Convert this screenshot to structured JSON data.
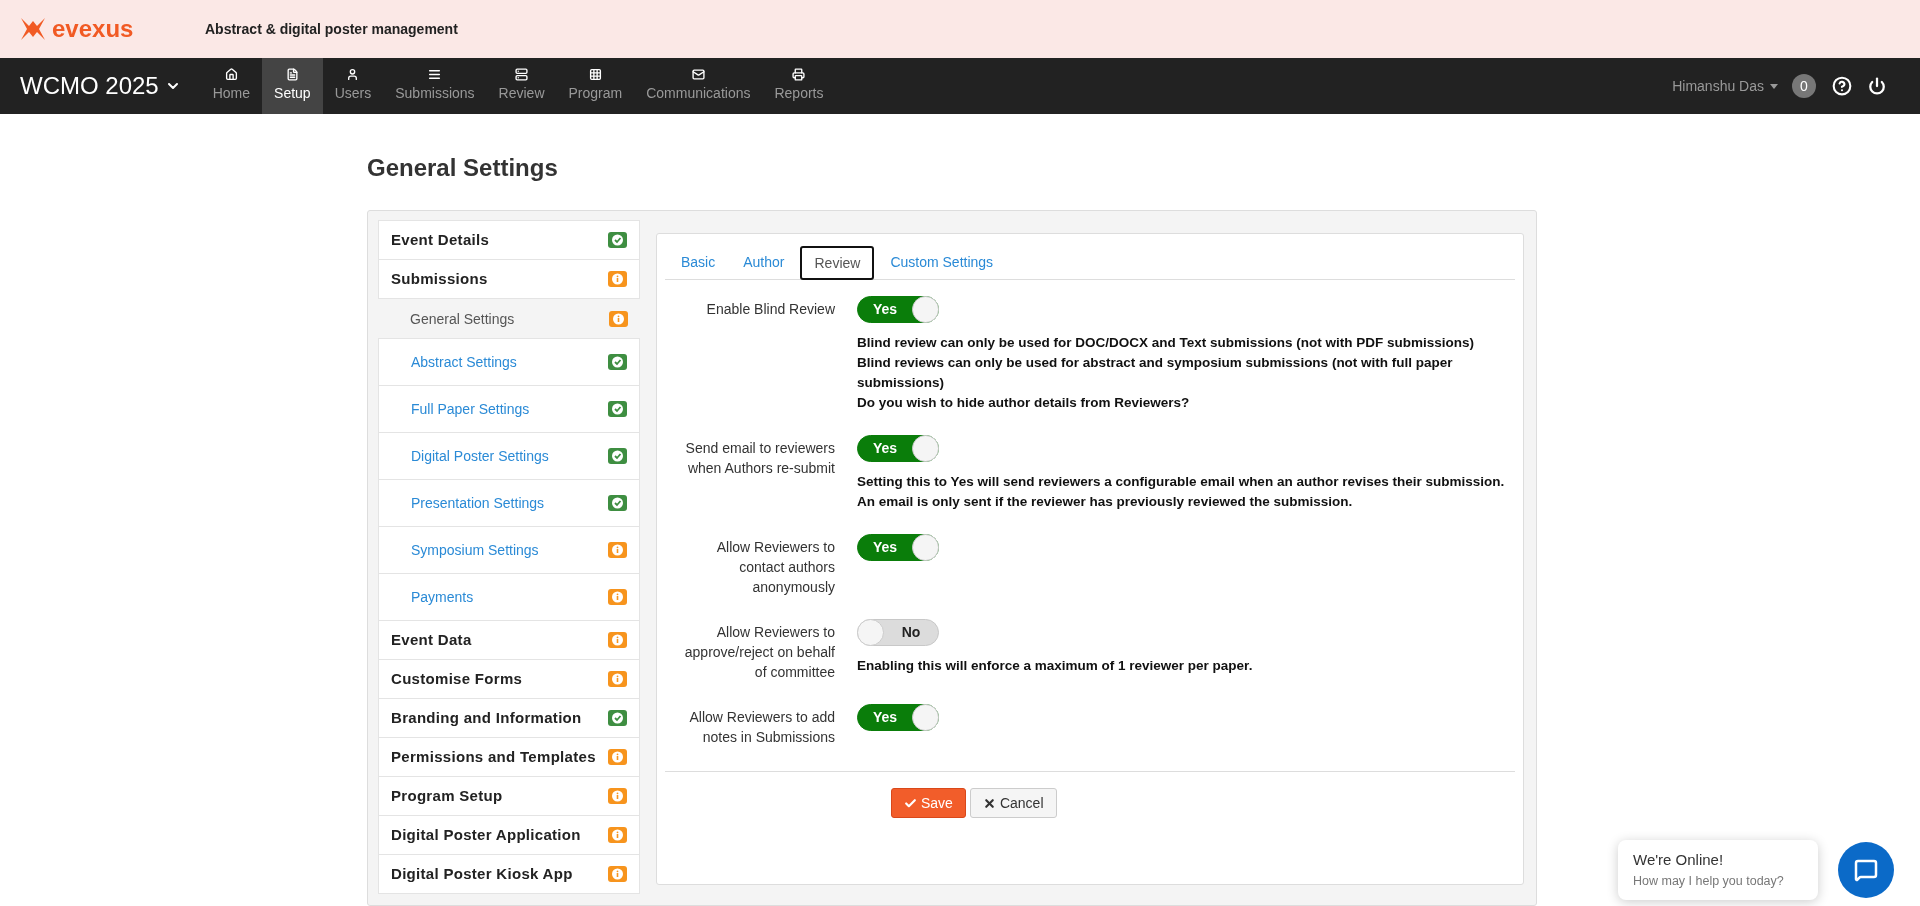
{
  "brand": {
    "name": "evexus",
    "tagline": "Abstract & digital poster management"
  },
  "nav": {
    "event": "WCMO 2025",
    "items": [
      {
        "label": "Home",
        "selected": false
      },
      {
        "label": "Setup",
        "selected": true
      },
      {
        "label": "Users",
        "selected": false
      },
      {
        "label": "Submissions",
        "selected": false
      },
      {
        "label": "Review",
        "selected": false
      },
      {
        "label": "Program",
        "selected": false
      },
      {
        "label": "Communications",
        "selected": false
      },
      {
        "label": "Reports",
        "selected": false
      }
    ],
    "user": "Himanshu Das",
    "count": "0"
  },
  "page_title": "General Settings",
  "sidebar": {
    "items": [
      {
        "label": "Event Details",
        "complete": true
      },
      {
        "label": "Submissions",
        "complete": false,
        "children": [
          {
            "label": "General Settings",
            "complete": false,
            "selected": true
          },
          {
            "label": "Abstract Settings",
            "complete": true,
            "selected": false
          },
          {
            "label": "Full Paper Settings",
            "complete": true,
            "selected": false
          },
          {
            "label": "Digital Poster Settings",
            "complete": true,
            "selected": false
          },
          {
            "label": "Presentation Settings",
            "complete": true,
            "selected": false
          },
          {
            "label": "Symposium Settings",
            "complete": false,
            "selected": false
          },
          {
            "label": "Payments",
            "complete": false,
            "selected": false
          }
        ]
      },
      {
        "label": "Event Data",
        "complete": false
      },
      {
        "label": "Customise Forms",
        "complete": false
      },
      {
        "label": "Branding and Information",
        "complete": true
      },
      {
        "label": "Permissions and Templates",
        "complete": false
      },
      {
        "label": "Program Setup",
        "complete": false
      },
      {
        "label": "Digital Poster Application",
        "complete": false
      },
      {
        "label": "Digital Poster Kiosk App",
        "complete": false
      }
    ]
  },
  "tabs": [
    {
      "label": "Basic",
      "selected": false
    },
    {
      "label": "Author",
      "selected": false
    },
    {
      "label": "Review",
      "selected": true
    },
    {
      "label": "Custom Settings",
      "selected": false
    }
  ],
  "settings": [
    {
      "label": "Enable Blind Review",
      "on": true,
      "value": "Yes",
      "notes": [
        "Blind review can only be used for DOC/DOCX and Text submissions (not with PDF submissions)",
        "Blind reviews can only be used for abstract and symposium submissions (not with full paper submissions)",
        "Do you wish to hide author details from Reviewers?"
      ]
    },
    {
      "label": "Send email to reviewers when Authors re-submit",
      "on": true,
      "value": "Yes",
      "notes": [
        "Setting this to Yes will send reviewers a configurable email when an author revises their submission.",
        "An email is only sent if the reviewer has previously reviewed the submission."
      ]
    },
    {
      "label": "Allow Reviewers to contact authors anonymously",
      "on": true,
      "value": "Yes"
    },
    {
      "label": "Allow Reviewers to approve/reject on behalf of committee",
      "on": false,
      "value": "No",
      "notes": [
        "Enabling this will enforce a maximum of 1 reviewer per paper."
      ]
    },
    {
      "label": "Allow Reviewers to add notes in Submissions",
      "on": true,
      "value": "Yes"
    }
  ],
  "buttons": {
    "save": "Save",
    "cancel": "Cancel"
  },
  "chat": {
    "title": "We're Online!",
    "subtitle": "How may I help you today?"
  }
}
